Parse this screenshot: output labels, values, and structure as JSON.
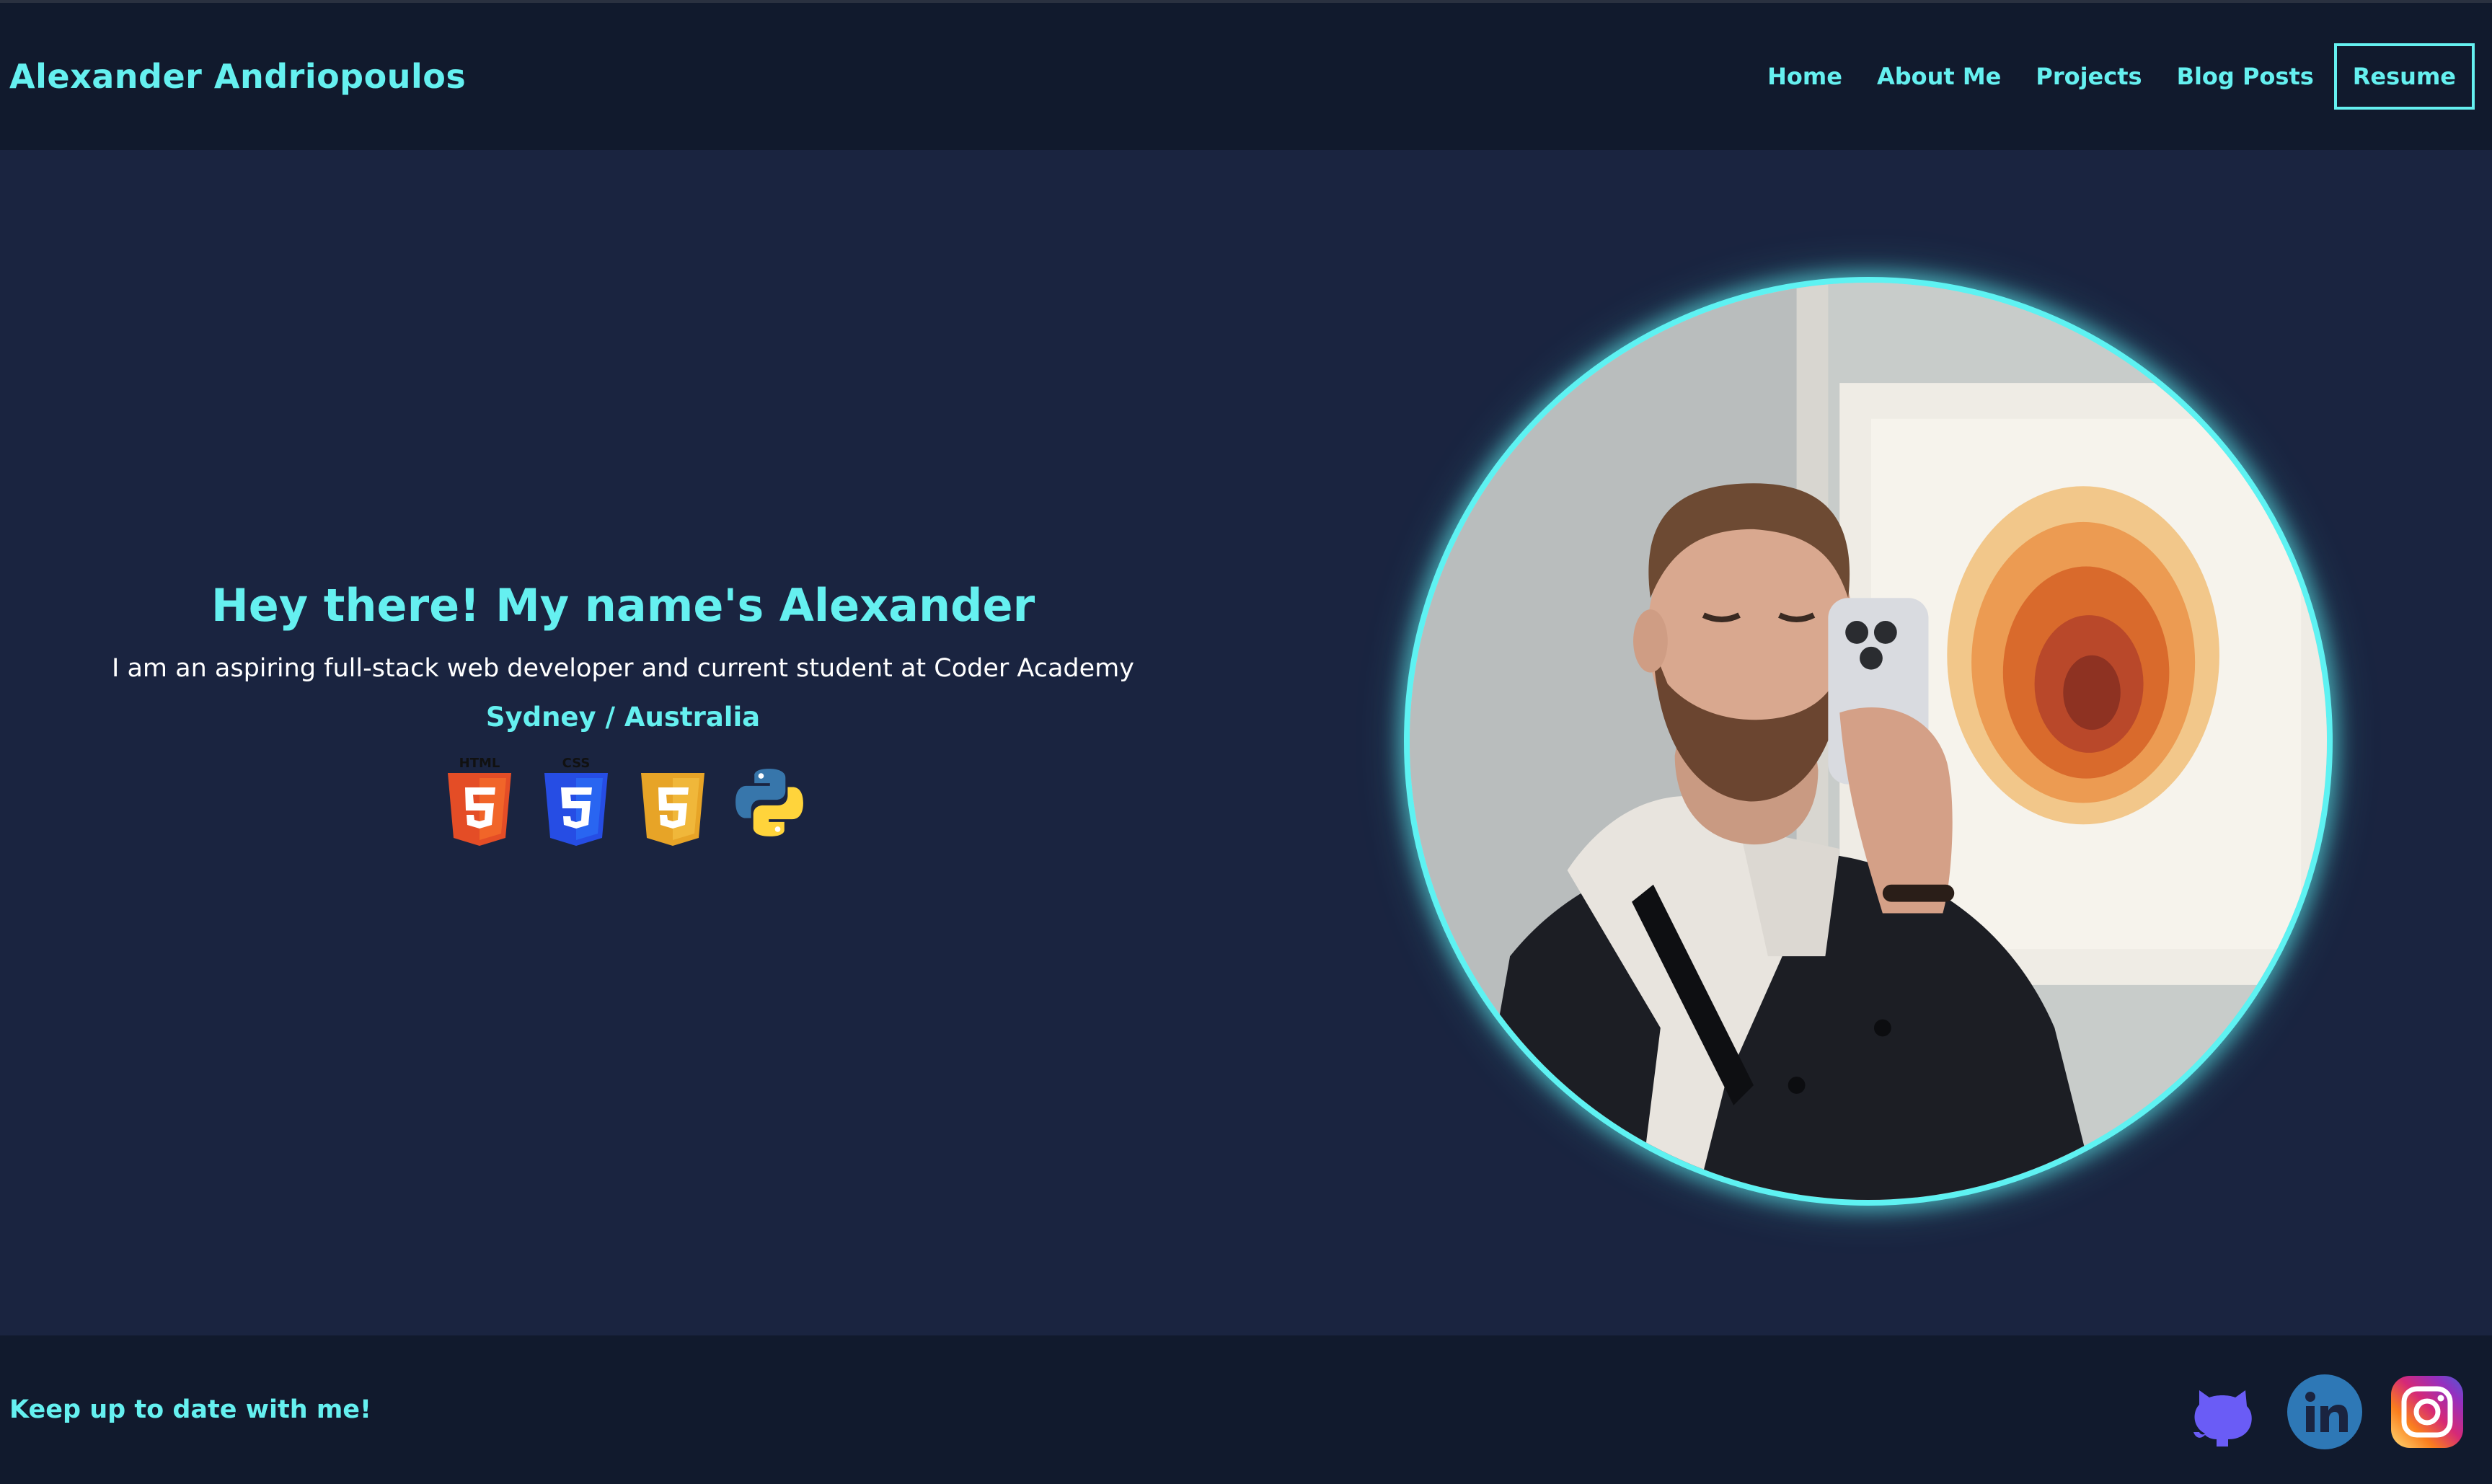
{
  "header": {
    "brand": "Alexander Andriopoulos",
    "nav": [
      {
        "label": "Home"
      },
      {
        "label": "About Me"
      },
      {
        "label": "Projects"
      },
      {
        "label": "Blog Posts"
      }
    ],
    "resume_label": "Resume"
  },
  "hero": {
    "title": "Hey there! My name's Alexander",
    "subtitle": "I am an aspiring full-stack web developer and current student at Coder Academy",
    "location": "Sydney / Australia",
    "tech_icons": [
      {
        "name": "html5-icon",
        "label": "HTML",
        "color": "#e44d26"
      },
      {
        "name": "css3-icon",
        "label": "CSS",
        "color": "#264de4"
      },
      {
        "name": "javascript-icon",
        "color": "#e7a427"
      },
      {
        "name": "python-icon",
        "colors": [
          "#3776ab",
          "#ffd43b"
        ]
      }
    ],
    "avatar": {
      "name": "profile-photo",
      "ring_color": "#5ef2f2"
    }
  },
  "footer": {
    "text": "Keep up to date with me!",
    "socials": [
      {
        "name": "github-icon",
        "color": "#6a5cf6"
      },
      {
        "name": "linkedin-icon",
        "color": "#2e78b6"
      },
      {
        "name": "instagram-icon",
        "colors": [
          "#feda75",
          "#d62976",
          "#962fbf",
          "#4f5bd5"
        ]
      }
    ]
  },
  "colors": {
    "accent": "#65f0f0",
    "background": "#1a2440",
    "bar": "#111a2d"
  }
}
